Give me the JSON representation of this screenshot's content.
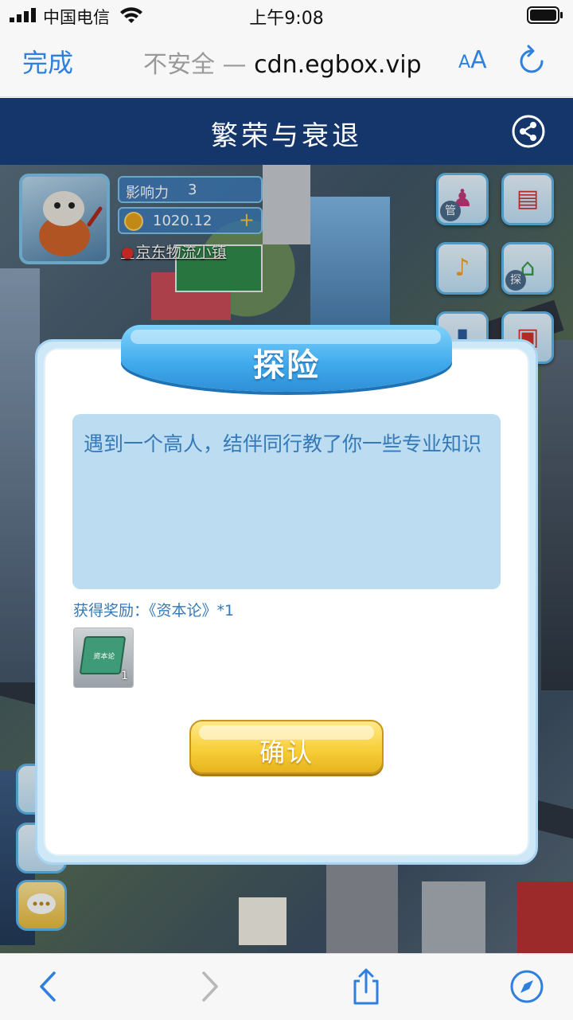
{
  "status_bar": {
    "carrier": "中国电信",
    "time": "上午9:08"
  },
  "browser": {
    "done_label": "完成",
    "url_insecure": "不安全 —",
    "url_domain": "cdn.egbox.vip",
    "aa_small": "A",
    "aa_big": "A",
    "accent": "#2f7fe0"
  },
  "page": {
    "title": "繁荣与衰退",
    "header_color": "#15366a"
  },
  "game": {
    "influence_label": "影响力",
    "influence_value": "3",
    "coins_value": "1020.12",
    "location": "京东物流小镇",
    "side_icons": [
      {
        "name": "manage-icon",
        "tag": "管"
      },
      {
        "name": "notepad-icon",
        "tag": ""
      },
      {
        "name": "bell-icon",
        "tag": ""
      },
      {
        "name": "explore-icon",
        "tag": "探"
      },
      {
        "name": "rank-icon",
        "tag": ""
      },
      {
        "name": "gift-icon",
        "tag": ""
      }
    ]
  },
  "modal": {
    "title": "探险",
    "message": "遇到一个高人，结伴同行教了你一些专业知识",
    "reward_text": "获得奖励：《资本论》*1",
    "reward_item_label": "资本论",
    "reward_item_count": "1",
    "confirm_label": "确认"
  }
}
